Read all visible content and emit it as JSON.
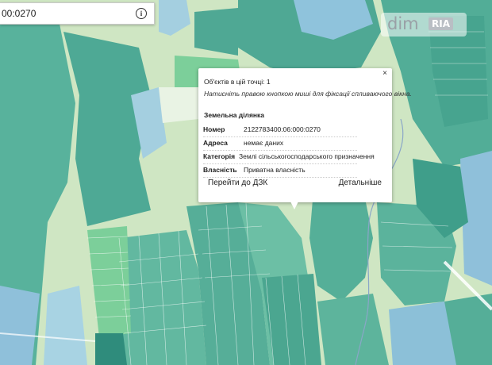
{
  "search": {
    "value": "00:0270"
  },
  "logo": {
    "brand": "dim",
    "badge": "RIA"
  },
  "popup": {
    "objects_count": "Об'єктів в цій точці: 1",
    "hint": "Натисніть правою кнопкою миші для фіксації спливаючого вікна.",
    "section_title": "Земельна ділянка",
    "rows": [
      {
        "label": "Номер",
        "value": "2122783400:06:000:0270"
      },
      {
        "label": "Адреса",
        "value": "немає даних"
      },
      {
        "label": "Категорія",
        "value": "Землі сільськогосподарського призначення"
      },
      {
        "label": "Власність",
        "value": "Приватна власність"
      }
    ],
    "link_dzk": "Перейти до ДЗК",
    "link_details": "Детальніше"
  },
  "colors": {
    "map_teal": "#52ad97",
    "map_light_green": "#cfe6c3",
    "map_blue": "#8fc0da",
    "map_bright_green": "#7ccf9a"
  }
}
